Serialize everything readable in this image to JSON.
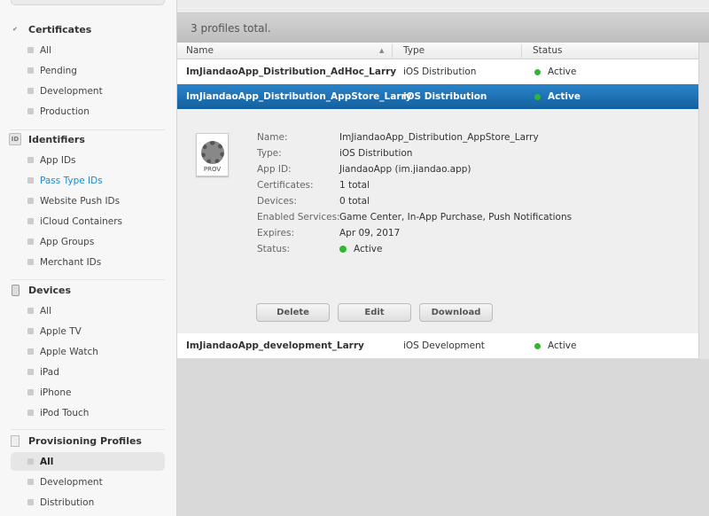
{
  "sidebar": {
    "sections": [
      {
        "title": "Certificates",
        "icon": "certificate-icon",
        "items": [
          "All",
          "Pending",
          "Development",
          "Production"
        ]
      },
      {
        "title": "Identifiers",
        "icon": "id-icon",
        "icon_text": "ID",
        "items": [
          "App IDs",
          "Pass Type IDs",
          "Website Push IDs",
          "iCloud Containers",
          "App Groups",
          "Merchant IDs"
        ]
      },
      {
        "title": "Devices",
        "icon": "device-icon",
        "items": [
          "All",
          "Apple TV",
          "Apple Watch",
          "iPad",
          "iPhone",
          "iPod Touch"
        ]
      },
      {
        "title": "Provisioning Profiles",
        "icon": "document-icon",
        "items": [
          "All",
          "Development",
          "Distribution"
        ]
      }
    ],
    "selected": "Provisioning Profiles / All",
    "highlighted_link": "Pass Type IDs"
  },
  "main": {
    "summary": "3 profiles total.",
    "columns": [
      "Name",
      "Type",
      "Status"
    ],
    "rows": [
      {
        "name": "ImJiandaoApp_Distribution_AdHoc_Larry",
        "type": "iOS Distribution",
        "status": "Active"
      },
      {
        "name": "ImJiandaoApp_Distribution_AppStore_Larry",
        "type": "iOS Distribution",
        "status": "Active",
        "selected": true
      },
      {
        "name": "ImJiandaoApp_development_Larry",
        "type": "iOS Development",
        "status": "Active"
      }
    ],
    "detail": {
      "icon_label": "PROV",
      "fields": [
        {
          "label": "Name:",
          "value": "ImJiandaoApp_Distribution_AppStore_Larry"
        },
        {
          "label": "Type:",
          "value": "iOS Distribution"
        },
        {
          "label": "App ID:",
          "value": "JiandaoApp (im.jiandao.app)"
        },
        {
          "label": "Certificates:",
          "value": "1 total"
        },
        {
          "label": "Devices:",
          "value": "0 total"
        },
        {
          "label": "Enabled Services:",
          "value": "Game Center, In-App Purchase, Push Notifications"
        },
        {
          "label": "Expires:",
          "value": "Apr 09, 2017"
        },
        {
          "label": "Status:",
          "value": "Active"
        }
      ],
      "buttons": [
        "Delete",
        "Edit",
        "Download"
      ]
    },
    "colors": {
      "active": "#2db92d",
      "selection": "#1d70b5",
      "link": "#1a8ad4"
    }
  }
}
